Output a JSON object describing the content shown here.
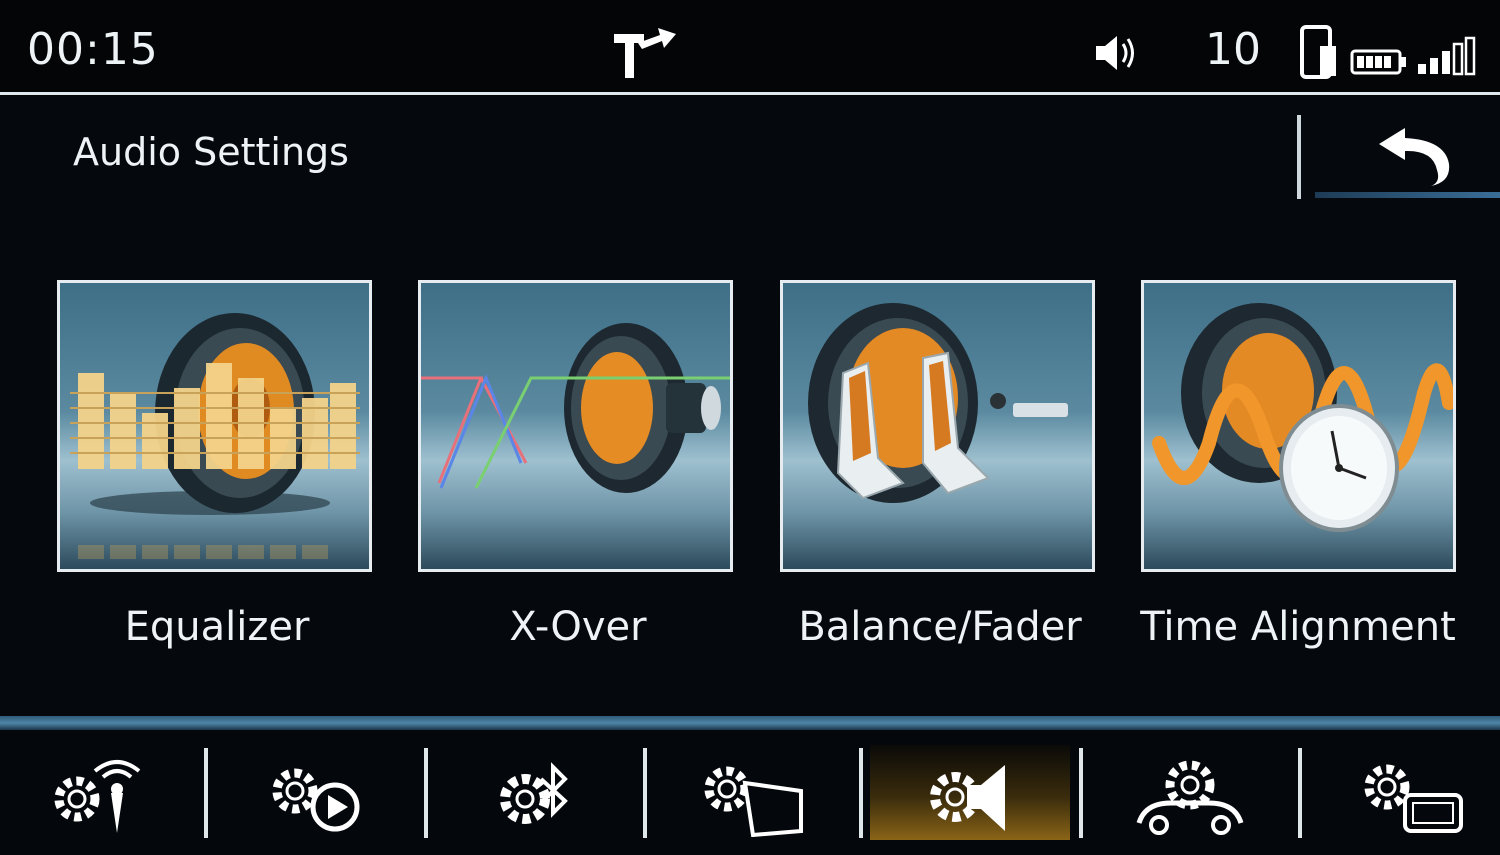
{
  "status": {
    "time": "00:15",
    "volume_level": "10",
    "icons": [
      "navigation-turn-icon",
      "speaker-icon",
      "phone-icon",
      "battery-icon",
      "signal-icon"
    ]
  },
  "header": {
    "title": "Audio Settings",
    "back_icon": "back-arrow-icon"
  },
  "tiles": [
    {
      "label": "Equalizer",
      "icon": "equalizer-speaker-icon"
    },
    {
      "label": "X-Over",
      "icon": "crossover-speaker-icon"
    },
    {
      "label": "Balance/Fader",
      "icon": "balance-fader-seats-icon"
    },
    {
      "label": "Time Alignment",
      "icon": "time-alignment-clock-icon"
    }
  ],
  "bottom_nav": [
    {
      "icon": "gear-antenna-icon",
      "active": false
    },
    {
      "icon": "gear-play-icon",
      "active": false
    },
    {
      "icon": "gear-bluetooth-icon",
      "active": false
    },
    {
      "icon": "gear-display-icon",
      "active": false
    },
    {
      "icon": "gear-speaker-icon",
      "active": true
    },
    {
      "icon": "gear-car-icon",
      "active": false
    },
    {
      "icon": "gear-screen-icon",
      "active": false
    }
  ],
  "colors": {
    "background": "#05090d",
    "accent_active": "#8a6417",
    "tile_orange": "#e48a1c",
    "text": "#eef3f5"
  }
}
